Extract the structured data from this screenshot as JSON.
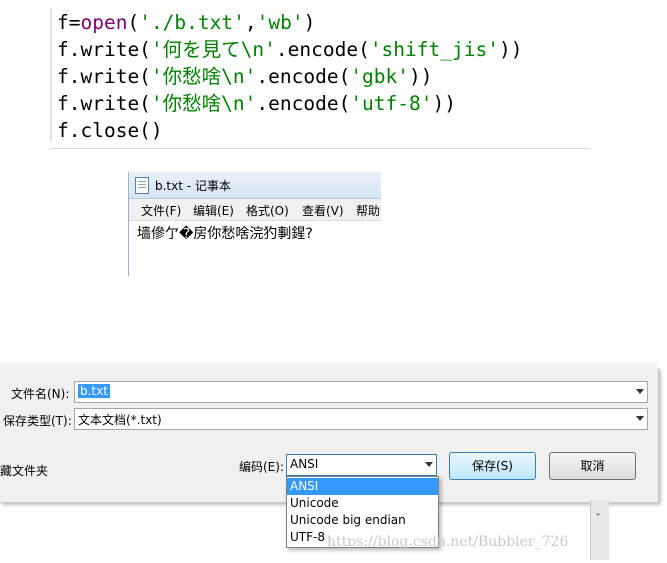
{
  "code": {
    "lines": [
      [
        [
          "plain",
          "f="
        ],
        [
          "kw",
          "open"
        ],
        [
          "plain",
          "("
        ],
        [
          "str",
          "'./b.txt'"
        ],
        [
          "plain",
          ","
        ],
        [
          "str",
          "'wb'"
        ],
        [
          "plain",
          ")"
        ]
      ],
      [
        [
          "plain",
          "f.write("
        ],
        [
          "str",
          "'何を見て\\n'"
        ],
        [
          "plain",
          ".encode("
        ],
        [
          "str",
          "'shift_jis'"
        ],
        [
          "plain",
          "))"
        ]
      ],
      [
        [
          "plain",
          "f.write("
        ],
        [
          "str",
          "'你愁啥\\n'"
        ],
        [
          "plain",
          ".encode("
        ],
        [
          "str",
          "'gbk'"
        ],
        [
          "plain",
          "))"
        ]
      ],
      [
        [
          "plain",
          "f.write("
        ],
        [
          "str",
          "'你愁啥\\n'"
        ],
        [
          "plain",
          ".encode("
        ],
        [
          "str",
          "'utf-8'"
        ],
        [
          "plain",
          "))"
        ]
      ],
      [
        [
          "plain",
          "f.close()"
        ]
      ]
    ]
  },
  "notepad": {
    "title": "b.txt - 记事本",
    "icon": "notepad-icon",
    "menus": [
      "文件(F)",
      "编辑(E)",
      "格式(O)",
      "查看(V)",
      "帮助"
    ],
    "content": "墙傪亇�房你愁啥浣犳剚鍟?"
  },
  "dialog": {
    "filename_label": "文件名(N):",
    "filename_value": "b.txt",
    "filetype_label": "保存类型(T):",
    "filetype_value": "文本文档(*.txt)",
    "hide_folders": "藏文件夹",
    "encoding_label": "编码(E):",
    "encoding_value": "ANSI",
    "encoding_options": [
      "ANSI",
      "Unicode",
      "Unicode big endian",
      "UTF-8"
    ],
    "encoding_selected_index": 0,
    "save_label": "保存(S)",
    "cancel_label": "取消"
  },
  "side": {
    "partial_char": "ˇ"
  },
  "watermark": "https://blog.csdn.net/Bubbler_726",
  "colors": {
    "keyword": "#7a0074",
    "string": "#008000",
    "selection": "#3399ff"
  }
}
